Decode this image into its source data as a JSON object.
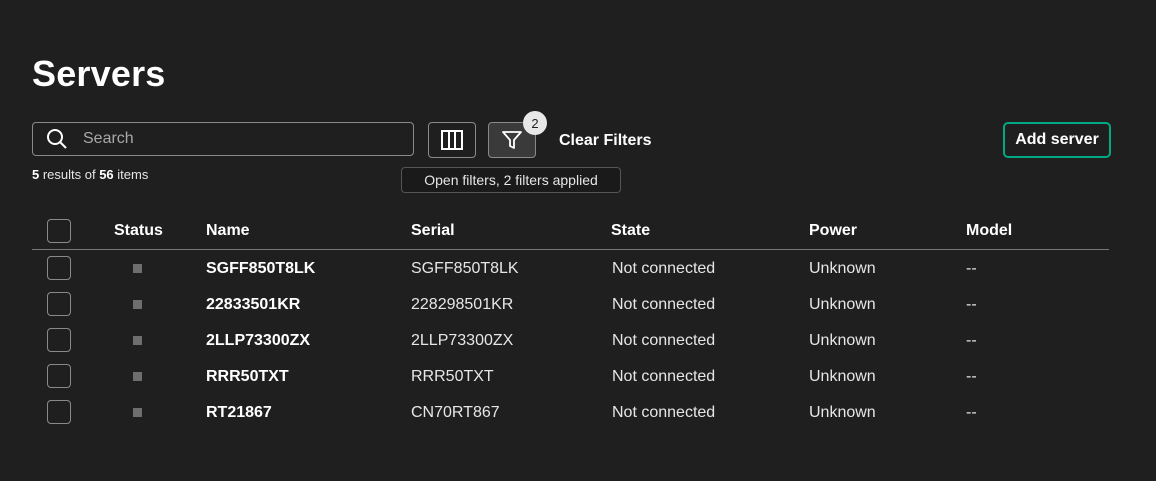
{
  "page": {
    "title": "Servers"
  },
  "toolbar": {
    "search_placeholder": "Search",
    "filter_count": "2",
    "clear_filters_label": "Clear Filters",
    "add_server_label": "Add server",
    "filter_tooltip": "Open filters, 2 filters applied"
  },
  "results": {
    "shown": "5",
    "middle": " results of ",
    "total": "56",
    "suffix": " items"
  },
  "table": {
    "headers": {
      "status": "Status",
      "name": "Name",
      "serial": "Serial",
      "state": "State",
      "power": "Power",
      "model": "Model"
    },
    "rows": [
      {
        "name": "SGFF850T8LK",
        "serial": "SGFF850T8LK",
        "state": "Not connected",
        "power": "Unknown",
        "model": "--"
      },
      {
        "name": "22833501KR",
        "serial": "228298501KR",
        "state": "Not connected",
        "power": "Unknown",
        "model": "--"
      },
      {
        "name": "2LLP73300ZX",
        "serial": "2LLP73300ZX",
        "state": "Not connected",
        "power": "Unknown",
        "model": "--"
      },
      {
        "name": "RRR50TXT",
        "serial": "RRR50TXT",
        "state": "Not connected",
        "power": "Unknown",
        "model": "--"
      },
      {
        "name": "RT21867",
        "serial": "CN70RT867",
        "state": "Not connected",
        "power": "Unknown",
        "model": "--"
      }
    ]
  },
  "colors": {
    "background": "#1f1f1f",
    "accent": "#01a982",
    "status_unknown": "#6e6e6e"
  },
  "icons": [
    "search-icon",
    "columns-icon",
    "filter-icon"
  ]
}
